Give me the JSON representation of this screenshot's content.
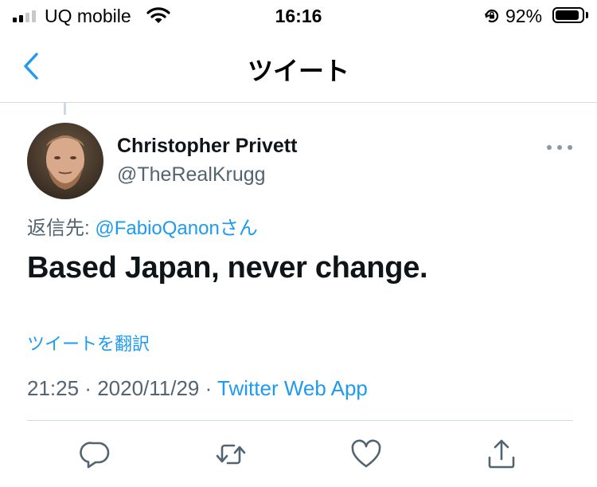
{
  "status_bar": {
    "carrier": "UQ mobile",
    "time": "16:16",
    "battery_percent_label": "92%",
    "battery_level": 0.92,
    "signal_bars_active": 2,
    "signal_bars_total": 4
  },
  "nav": {
    "title": "ツイート",
    "back_icon": "chevron-left-icon"
  },
  "tweet": {
    "author_name": "Christopher Privett",
    "author_handle": "@TheRealKrugg",
    "reply_prefix": "返信先: ",
    "reply_mention": "@FabioQanonさん",
    "text": "Based Japan, never change.",
    "translate_label": "ツイートを翻訳",
    "time": "21:25",
    "date": "2020/11/29",
    "separator": " · ",
    "source": "Twitter Web App"
  },
  "actions": [
    {
      "name": "reply",
      "icon": "reply-icon"
    },
    {
      "name": "retweet",
      "icon": "retweet-icon"
    },
    {
      "name": "like",
      "icon": "heart-icon"
    },
    {
      "name": "share",
      "icon": "share-icon"
    }
  ],
  "colors": {
    "accent": "#1d9bf0",
    "secondary_text": "#536471",
    "icon_gray": "#536471",
    "divider": "#cfd9de"
  }
}
